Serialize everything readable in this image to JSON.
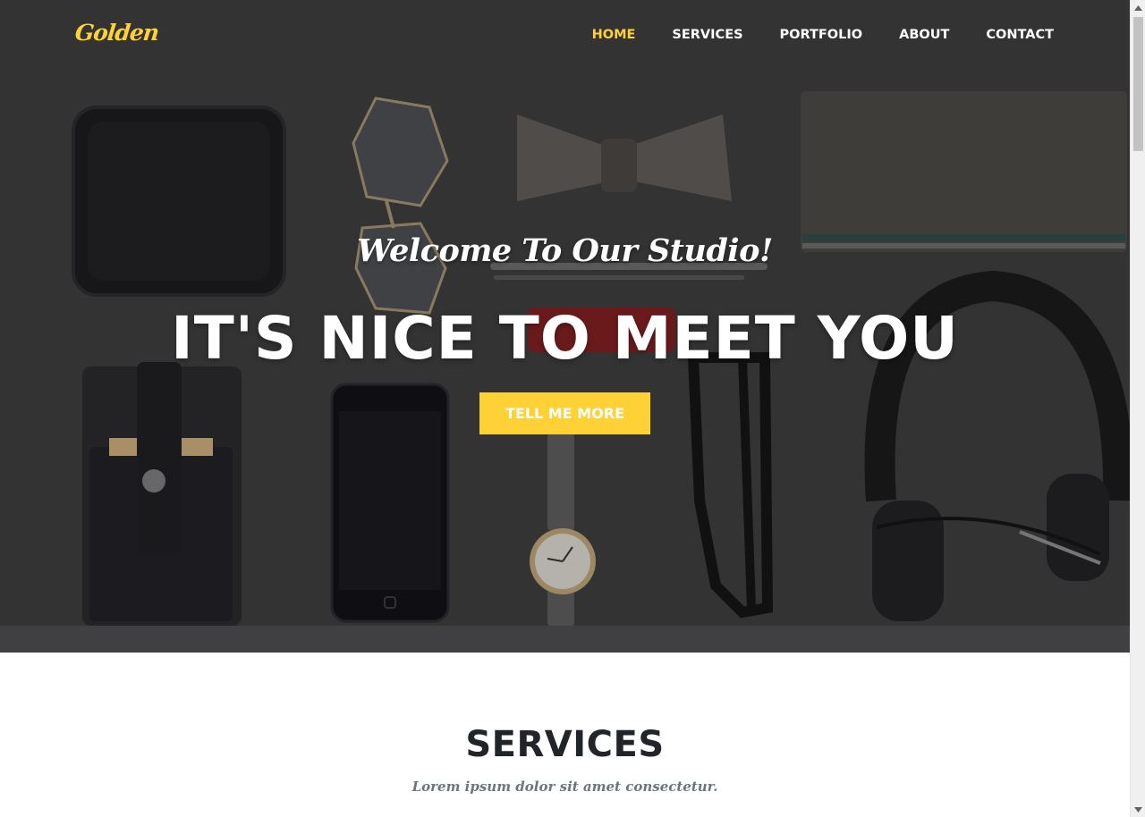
{
  "brand": {
    "name": "Golden",
    "color": "#fed136"
  },
  "nav": {
    "items": [
      {
        "label": "HOME",
        "active": true
      },
      {
        "label": "SERVICES",
        "active": false
      },
      {
        "label": "PORTFOLIO",
        "active": false
      },
      {
        "label": "ABOUT",
        "active": false
      },
      {
        "label": "CONTACT",
        "active": false
      }
    ]
  },
  "hero": {
    "lead": "Welcome To Our Studio!",
    "heading": "IT'S NICE TO MEET YOU",
    "button": "TELL ME MORE",
    "background_image": "flat-lay-accessories-photo"
  },
  "services": {
    "heading": "SERVICES",
    "subheading": "Lorem ipsum dolor sit amet consectetur."
  },
  "colors": {
    "accent": "#fed136",
    "hero_overlay": "#3a3a3c",
    "heading_text": "#212529",
    "muted_text": "#6c757d"
  },
  "icons": [
    "scroll-up-arrow-icon",
    "scroll-down-arrow-icon"
  ]
}
